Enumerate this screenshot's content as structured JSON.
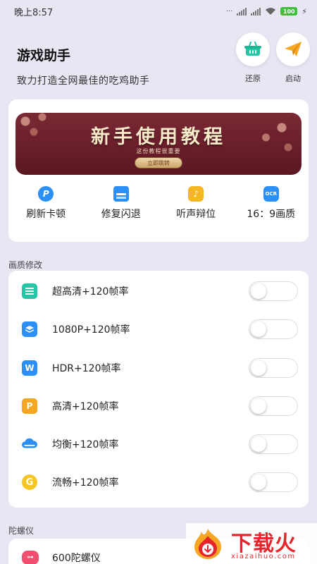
{
  "status_bar": {
    "time": "晚上8:57",
    "battery": "100"
  },
  "header": {
    "title": "游戏助手",
    "subtitle": "致力打造全网最佳的吃鸡助手",
    "actions": [
      {
        "label": "还原",
        "icon": "basket-icon",
        "color": "#23c7a5"
      },
      {
        "label": "启动",
        "icon": "paper-plane-icon",
        "color": "#f5a623"
      }
    ]
  },
  "banner": {
    "title": "新手使用教程",
    "subtitle": "这份教程很重要",
    "button": "立即跳转"
  },
  "quick_actions": [
    {
      "label": "刷新卡顿",
      "icon": "p-badge-icon",
      "color": "#2b8ff5"
    },
    {
      "label": "修复闪退",
      "icon": "stack-icon",
      "color": "#2b8ff5"
    },
    {
      "label": "听声辩位",
      "icon": "audio-icon",
      "color": "#f5b623"
    },
    {
      "label": "16：9画质",
      "icon": "ocr-icon",
      "color": "#2b8ff5"
    }
  ],
  "quality_section": {
    "title": "画质修改",
    "items": [
      {
        "label": "超高清+120帧率",
        "icon": "document-icon",
        "color": "#23c7a5",
        "enabled": false
      },
      {
        "label": "1080P+120帧率",
        "icon": "layers-icon",
        "color": "#2b8ff5",
        "enabled": false
      },
      {
        "label": "HDR+120帧率",
        "icon": "w-letter-icon",
        "color": "#2b8ff5",
        "enabled": false
      },
      {
        "label": "高清+120帧率",
        "icon": "p-letter-icon",
        "color": "#f5a623",
        "enabled": false
      },
      {
        "label": "均衡+120帧率",
        "icon": "cloud-icon",
        "color": "#2b8ff5",
        "enabled": false
      },
      {
        "label": "流畅+120帧率",
        "icon": "g-letter-icon",
        "color": "#f5c623",
        "enabled": false
      }
    ]
  },
  "gyro_section": {
    "title": "陀螺仪",
    "items": [
      {
        "label": "600陀螺仪",
        "icon": "gyro-icon",
        "color": "#f0506e"
      }
    ]
  },
  "watermark": {
    "brand": "下载火",
    "url": "xiazaihuo.com"
  }
}
